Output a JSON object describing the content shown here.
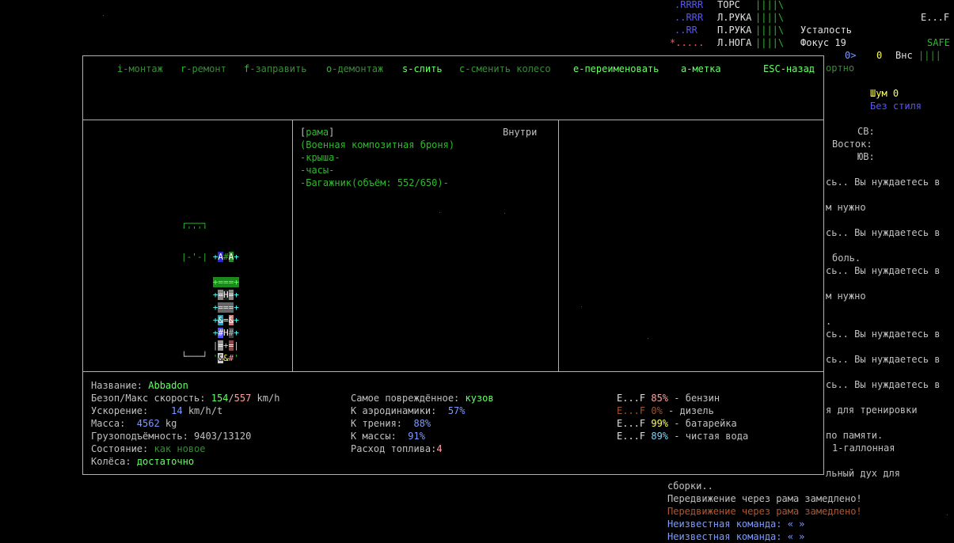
{
  "bodyparts": [
    {
      "grid": "RRRR",
      "name": "ТОРС",
      "bar": "||||\\"
    },
    {
      "grid": "..RRR",
      "name": "Л.РУКА",
      "bar": "||||\\"
    },
    {
      "grid": "..RR",
      "name": "П.РУКА",
      "bar": "||||\\"
    },
    {
      "grid": "*.....",
      "name": "Л.НОГА",
      "bar": "||||\\"
    }
  ],
  "status": {
    "fatigue": "Усталость",
    "focus": "Фокус 19",
    "ef": "E...F",
    "safe": "SAFE",
    "speed": "0>",
    "zero": "0",
    "vns": "Внс",
    "vns_bar": "||||",
    "ortno": "ортно",
    "noise": "Шум 0",
    "style": "Без стиля",
    "dir_sv": "СВ:",
    "dir_east": "Восток:",
    "dir_yv": "ЮВ:"
  },
  "log_right": [
    "сь.. Вы нуждаетесь в",
    "м нужно",
    "сь.. Вы нуждаетесь в",
    "боль.",
    "сь.. Вы нуждаетесь в",
    "м нужно",
    ".",
    "сь.. Вы нуждаетесь в",
    "сь.. Вы нуждаетесь в",
    "сь.. Вы нуждаетесь в",
    "я для тренировки",
    "по памяти.",
    "1-галлонная",
    "льный дух для"
  ],
  "log_bottom": [
    "сборки..",
    "Передвижение через рама замедлено!",
    "Передвижение через рама замедлено!",
    "Неизвестная команда: « »",
    "Неизвестная команда: « »"
  ],
  "menu": [
    {
      "key": "i",
      "label": "-монтаж"
    },
    {
      "key": "r",
      "label": "-ремонт"
    },
    {
      "key": "f",
      "label": "-заправить"
    },
    {
      "key": "o",
      "label": "-демонтаж"
    },
    {
      "key": "s",
      "label": "-слить"
    },
    {
      "key": "c",
      "label": "-сменить колесо"
    },
    {
      "key": "e",
      "label": "-переименовать"
    },
    {
      "key": "a",
      "label": "-метка"
    },
    {
      "key": "ESC",
      "label": "-назад"
    }
  ],
  "parts": {
    "header_open": "[",
    "header_name": "рама",
    "header_close": "]",
    "inside": "Внутри",
    "armor": "(Военная композитная броня)",
    "items": [
      "-крыша-",
      "-часы-",
      "-Багажник(объём: 552/650)-"
    ]
  },
  "vehicle_map": {
    "top": "┌───┐",
    "dots": "'''''",
    "rows": [
      "+A#A+",
      "|-'-|",
      "+===+",
      "+=H=+",
      "+===+",
      "+&=&+",
      "+#H#+",
      "|=+=|",
      "'&&#'",
      "└───┘"
    ]
  },
  "stats": {
    "name_label": "Название: ",
    "name_value": "Abbadon",
    "speed_label": "Безоп/Макс скорость: ",
    "speed_safe": "154",
    "speed_sep": "/",
    "speed_max": "557",
    "speed_unit": " km/h",
    "accel_label": "Ускорение:  ",
    "accel_value": "14",
    "accel_unit": " km/h/t",
    "mass_label": "Масса:  ",
    "mass_value": "4562",
    "mass_unit": " kg",
    "cargo_label": "Грузоподъёмность: ",
    "cargo_value": "9403/13120",
    "cond_label": "Состояние: ",
    "cond_value": "как новое",
    "wheels_label": "Колёса: ",
    "wheels_value": "достаточно",
    "damaged_label": "Самое повреждённое: ",
    "damaged_value": "кузов",
    "aero_label": "К аэродинамики:  ",
    "aero_value": "57%",
    "friction_label": "К трения:  ",
    "friction_value": "88%",
    "massk_label": "К массы:  ",
    "massk_value": "91%",
    "fuel_label": "Расход топлива:",
    "fuel_value": "4"
  },
  "fuels": [
    {
      "gauge": "E...F",
      "pct": "85%",
      "name": " - бензин",
      "color": "#ffa0a0"
    },
    {
      "gauge": "E...F",
      "pct": "0%",
      "name": " - дизель",
      "color": "#a0522d"
    },
    {
      "gauge": "E...F",
      "pct": "99%",
      "name": " - батарейка",
      "color": "#ffff55"
    },
    {
      "gauge": "E...F",
      "pct": "89%",
      "name": " - чистая вода",
      "color": "#7dd3ff"
    }
  ]
}
